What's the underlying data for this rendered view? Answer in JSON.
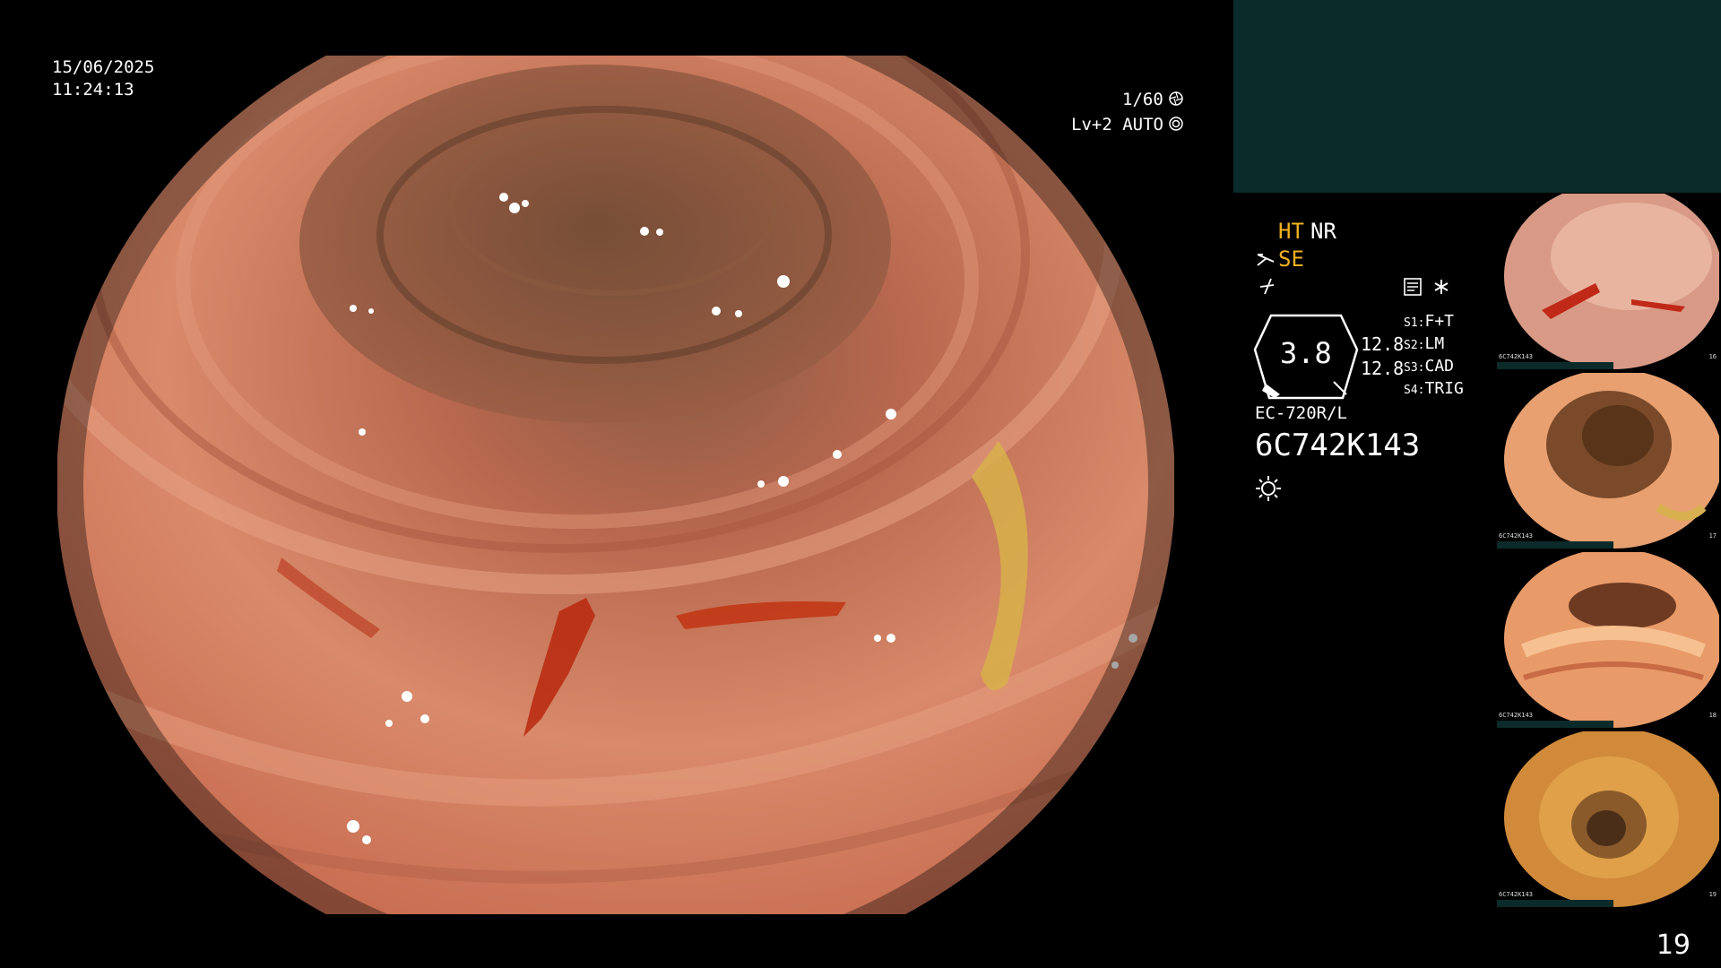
{
  "datetime": {
    "date": "15/06/2025",
    "time": "11:24:13"
  },
  "exposure": {
    "shutter": "1/60",
    "level": "Lv+2 AUTO"
  },
  "enhancement": {
    "ht": "HT",
    "nr": "NR",
    "se": "SE"
  },
  "settings": {
    "dial_value": "3.8",
    "value_upper": "12.8",
    "value_lower": "12.8",
    "switches": [
      {
        "key": "S1:",
        "value": "F+T"
      },
      {
        "key": "S2:",
        "value": "LM"
      },
      {
        "key": "S3:",
        "value": "CAD"
      },
      {
        "key": "S4:",
        "value": "TRIG"
      }
    ]
  },
  "scope": {
    "model": "EC-720R/L",
    "serial": "6C742K143"
  },
  "icons": {
    "shutter": "aperture-icon",
    "auto": "auto-iris-icon",
    "scissors": "scissors-icon",
    "mode": "squiggle-icon",
    "memo": "memo-icon",
    "star": "asterisk-icon",
    "light": "light-sun-icon"
  },
  "thumbnails": [
    {
      "label": "6C742K143",
      "number": "16"
    },
    {
      "label": "6C742K143",
      "number": "17"
    },
    {
      "label": "6C742K143",
      "number": "18"
    },
    {
      "label": "6C742K143",
      "number": "19"
    }
  ],
  "page_number": "19",
  "colors": {
    "panel_teal": "#0b2b2a",
    "accent_yellow": "#f0b020"
  }
}
